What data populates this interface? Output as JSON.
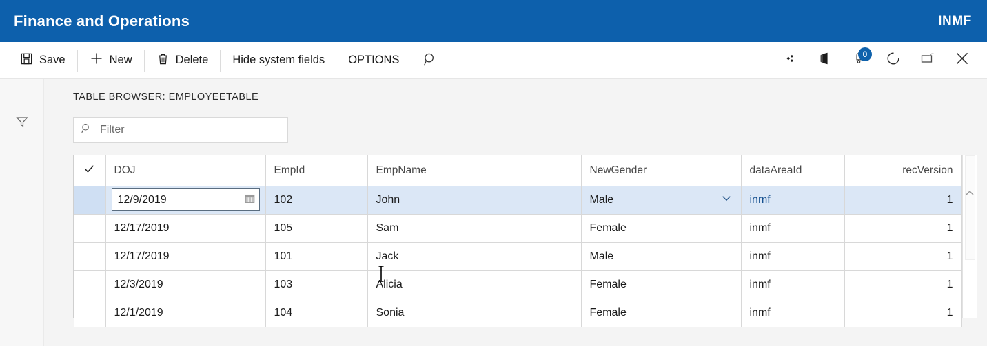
{
  "titlebar": {
    "app_title": "Finance and Operations",
    "company_code": "INMF",
    "background": "#0d60ac"
  },
  "commandbar": {
    "buttons": [
      {
        "label": "Save",
        "icon": "save-icon"
      },
      {
        "label": "New",
        "icon": "plus-icon"
      },
      {
        "label": "Delete",
        "icon": "trash-icon"
      },
      {
        "label": "Hide system fields",
        "icon": "none"
      },
      {
        "label": "OPTIONS",
        "icon": "none"
      }
    ],
    "search_icon": "search-icon",
    "right_icons": [
      {
        "name": "settings-diamond-icon"
      },
      {
        "name": "office-app-launcher-icon"
      },
      {
        "name": "notifications-bell-icon",
        "badge": "0"
      },
      {
        "name": "refresh-icon"
      },
      {
        "name": "popout-window-icon"
      },
      {
        "name": "close-icon"
      }
    ],
    "badge_color": "#0f62ac"
  },
  "leftrail": {
    "filter_icon": "filter-funnel-icon"
  },
  "content": {
    "browser_label": "TABLE BROWSER: EMPLOYEETABLE",
    "filter": {
      "placeholder": "Filter",
      "value": "",
      "icon": "search-icon"
    }
  },
  "grid": {
    "select_all_icon": "checkmark-icon",
    "columns": [
      {
        "key": "check",
        "label": "",
        "align": "center"
      },
      {
        "key": "doj",
        "label": "DOJ",
        "align": "left"
      },
      {
        "key": "empid",
        "label": "EmpId",
        "align": "left"
      },
      {
        "key": "empname",
        "label": "EmpName",
        "align": "left"
      },
      {
        "key": "newgender",
        "label": "NewGender",
        "align": "left"
      },
      {
        "key": "dataareaid",
        "label": "dataAreaId",
        "align": "left"
      },
      {
        "key": "recversion",
        "label": "recVersion",
        "align": "right"
      }
    ],
    "rows": [
      {
        "doj": "12/9/2019",
        "empid": "102",
        "empname": "John",
        "newgender": "Male",
        "dataareaid": "inmf",
        "recversion": "1",
        "selected": true
      },
      {
        "doj": "12/17/2019",
        "empid": "105",
        "empname": "Sam",
        "newgender": "Female",
        "dataareaid": "inmf",
        "recversion": "1",
        "selected": false
      },
      {
        "doj": "12/17/2019",
        "empid": "101",
        "empname": "Jack",
        "newgender": "Male",
        "dataareaid": "inmf",
        "recversion": "1",
        "selected": false
      },
      {
        "doj": "12/3/2019",
        "empid": "103",
        "empname": "Alicia",
        "newgender": "Female",
        "dataareaid": "inmf",
        "recversion": "1",
        "selected": false
      },
      {
        "doj": "12/1/2019",
        "empid": "104",
        "empname": "Sonia",
        "newgender": "Female",
        "dataareaid": "inmf",
        "recversion": "1",
        "selected": false
      }
    ],
    "active_cell": {
      "row": 0,
      "column": "doj",
      "value": "12/9/2019",
      "picker_icon": "calendar-icon"
    },
    "gender_dropdown_icon": "chevron-down-icon",
    "selected_row_color": "#dbe7f6",
    "scroll_up_icon": "chevron-up-icon"
  }
}
